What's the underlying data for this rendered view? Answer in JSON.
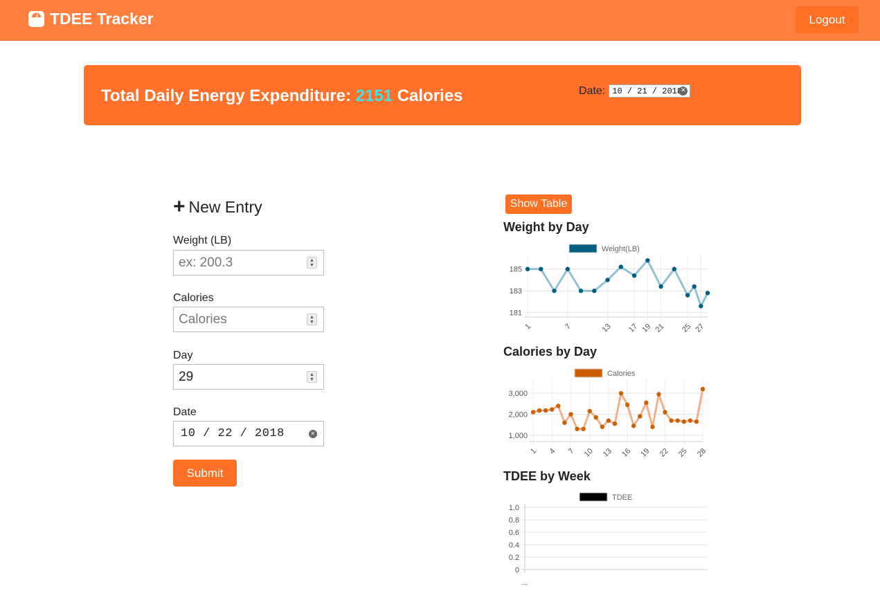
{
  "navbar": {
    "brand": "TDEE Tracker",
    "logout_label": "Logout"
  },
  "banner": {
    "prefix": "Total Daily Energy Expenditure: ",
    "tdee": "2151",
    "suffix": " Calories",
    "date_label": "Date:",
    "date_value": "10 / 21 / 2018"
  },
  "form": {
    "title": "New Entry",
    "weight_label": "Weight (LB)",
    "weight_placeholder": "ex: 200.3",
    "calories_label": "Calories",
    "calories_placeholder": "Calories",
    "day_label": "Day",
    "day_value": "29",
    "date_label": "Date",
    "date_value": "10 / 22 / 2018",
    "submit_label": "Submit"
  },
  "charts_panel": {
    "show_table_label": "Show Table"
  },
  "colors": {
    "weight": "#005f7f",
    "weight_line": "#8fc3d3",
    "calories": "#cc5f00",
    "calories_line": "#f0b08a",
    "tdee": "#000000",
    "accent": "#ff6f24"
  },
  "chart_data": [
    {
      "type": "line",
      "title": "Weight by Day",
      "series": [
        {
          "name": "Weight(LB)",
          "values": [
            185,
            185,
            183,
            185,
            183,
            183,
            184,
            185.2,
            184.4,
            185.8,
            183.4,
            185,
            182.6,
            183.4,
            181.6,
            182.8
          ]
        }
      ],
      "x": [
        1,
        3,
        5,
        7,
        9,
        11,
        13,
        15,
        17,
        19,
        21,
        23,
        25,
        26,
        27,
        28
      ],
      "xticks": [
        "1",
        "7",
        "13",
        "17",
        "19",
        "21",
        "25",
        "27"
      ],
      "yticks": [
        181,
        183,
        185
      ],
      "ylim": [
        180.6,
        186
      ],
      "legend": "top"
    },
    {
      "type": "line",
      "title": "Calories by Day",
      "series": [
        {
          "name": "Calories",
          "values": [
            2100,
            2180,
            2180,
            2230,
            2400,
            1600,
            2000,
            1300,
            1300,
            2150,
            1850,
            1400,
            1700,
            1550,
            3000,
            2450,
            1450,
            1900,
            2550,
            1400,
            2950,
            2100,
            1700,
            1700,
            1650,
            1700,
            1650,
            3200
          ]
        }
      ],
      "x": [
        1,
        2,
        3,
        4,
        5,
        6,
        7,
        8,
        9,
        10,
        11,
        12,
        13,
        14,
        15,
        16,
        17,
        18,
        19,
        20,
        21,
        22,
        23,
        24,
        25,
        26,
        27,
        28
      ],
      "xticks": [
        "1",
        "4",
        "7",
        "10",
        "13",
        "16",
        "19",
        "22",
        "25",
        "28"
      ],
      "yticks": [
        "1,000",
        "2,000",
        "3,000"
      ],
      "ylim": [
        700,
        3500
      ],
      "legend": "top"
    },
    {
      "type": "line",
      "title": "TDEE by Week",
      "series": [
        {
          "name": "TDEE",
          "values": []
        }
      ],
      "xticks": [
        "..."
      ],
      "yticks": [
        "0",
        "0.2",
        "0.4",
        "0.6",
        "0.8",
        "1.0"
      ],
      "ylim": [
        0,
        1
      ],
      "legend": "top"
    }
  ]
}
